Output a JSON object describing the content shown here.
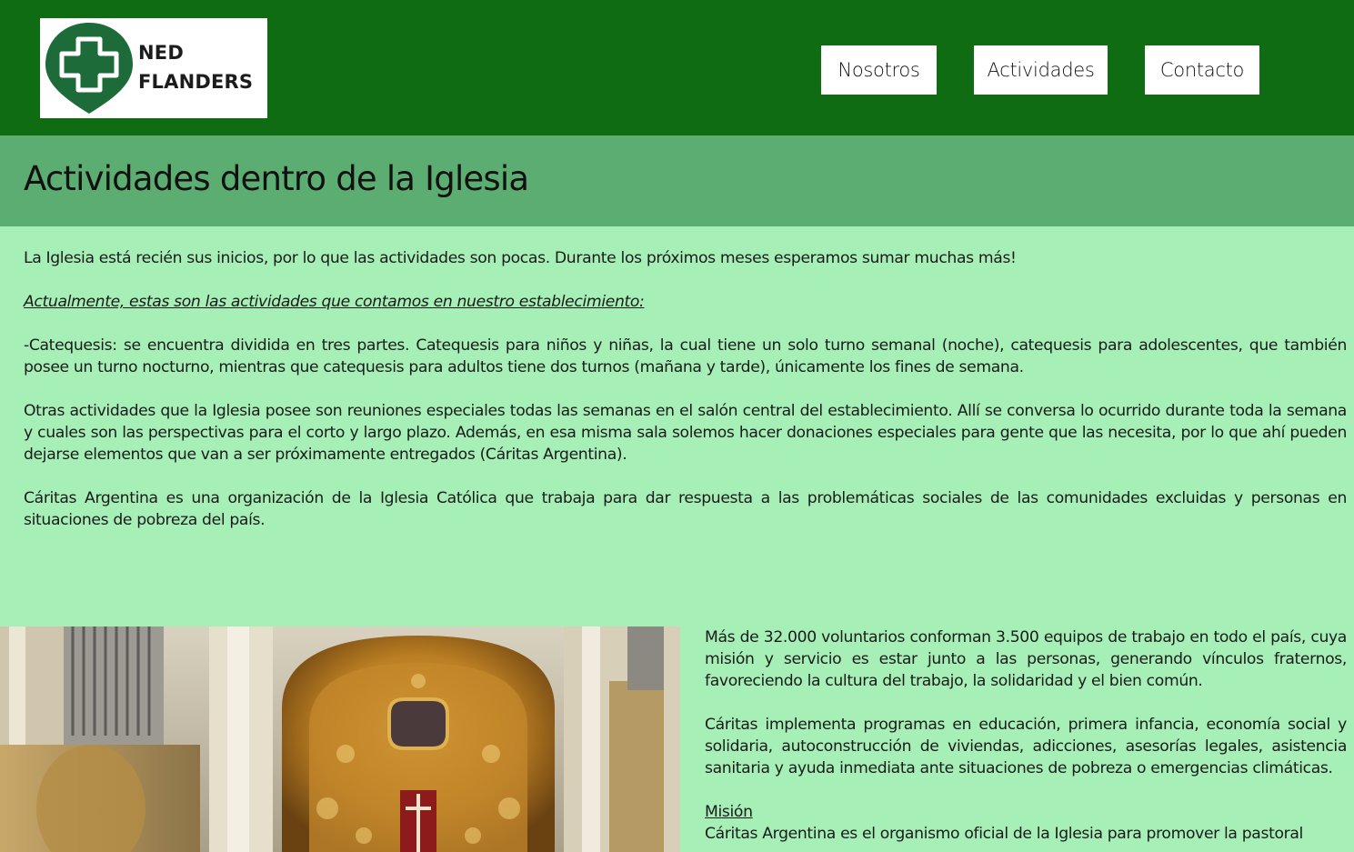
{
  "header": {
    "logo": {
      "line1": "NED",
      "line2": "FLANDERS",
      "icon": "cross-pin-icon",
      "color": "#1e6b3a"
    },
    "nav": [
      {
        "label": "Nosotros"
      },
      {
        "label": "Actividades"
      },
      {
        "label": "Contacto"
      }
    ],
    "background": "#0f6c12"
  },
  "banner": {
    "title": "Actividades dentro de la Iglesia",
    "background": "#5cad72"
  },
  "main": {
    "intro": "La Iglesia está recién sus inicios, por lo que las actividades son pocas. Durante los próximos meses esperamos sumar muchas más!",
    "subheading": "Actualmente, estas son las actividades que contamos en nuestro establecimiento:",
    "catequesis": "-Catequesis: se encuentra dividida en tres partes. Catequesis para niños y niñas, la cual tiene un solo turno semanal (noche), catequesis para adolescentes, que también posee un turno nocturno, mientras que catequesis para adultos tiene dos turnos (mañana y tarde), únicamente los fines de semana.",
    "otras": "Otras actividades que la Iglesia posee son reuniones especiales todas las semanas en el salón central del establecimiento. Allí se conversa lo ocurrido durante toda la semana y cuales son las perspectivas para el corto y largo plazo. Además, en esa misma sala solemos hacer donaciones especiales para gente que las necesita, por lo que ahí pueden dejarse elementos que van a ser próximamente entregados (Cáritas Argentina).",
    "caritas": "Cáritas Argentina es una organización de la Iglesia Católica que trabaja para dar respuesta a las problemáticas sociales de las comunidades excluidas y personas en situaciones de pobreza del país.",
    "background": "#a6f0b8"
  },
  "side": {
    "voluntarios": "Más de 32.000 voluntarios conforman 3.500 equipos de trabajo en todo el país, cuya misión y servicio es estar junto a las personas, generando vínculos fraternos, favoreciendo la cultura del trabajo, la solidaridad y el bien común.",
    "programas": "Cáritas implementa programas en educación, primera infancia, economía social y solidaria, autoconstrucción de viviendas, adicciones, asesorías legales, asistencia sanitaria y ayuda inmediata ante situaciones de pobreza o emergencias climáticas.",
    "mision_heading": "Misión",
    "mision_text": "Cáritas Argentina es el organismo oficial de la Iglesia para promover la pastoral"
  },
  "image": {
    "icon": "church-altar-image"
  }
}
